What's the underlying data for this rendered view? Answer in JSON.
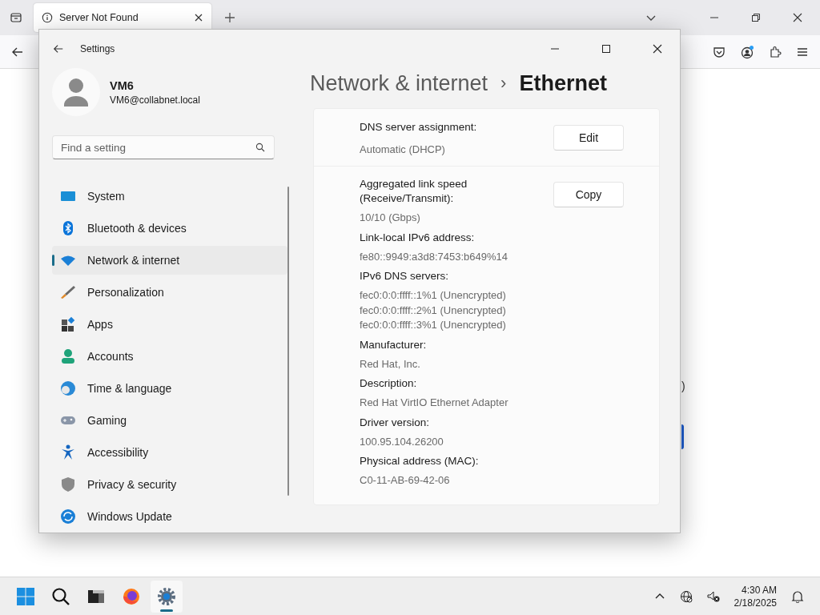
{
  "browser": {
    "tab": {
      "title": "Server Not Found",
      "selected": true
    },
    "page_fragment": ")"
  },
  "settings": {
    "title": "Settings",
    "user": {
      "name": "VM6",
      "email": "VM6@collabnet.local"
    },
    "search": {
      "placeholder": "Find a setting"
    },
    "nav": [
      {
        "label": "System",
        "selected": false
      },
      {
        "label": "Bluetooth & devices",
        "selected": false
      },
      {
        "label": "Network & internet",
        "selected": true
      },
      {
        "label": "Personalization",
        "selected": false
      },
      {
        "label": "Apps",
        "selected": false
      },
      {
        "label": "Accounts",
        "selected": false
      },
      {
        "label": "Time & language",
        "selected": false
      },
      {
        "label": "Gaming",
        "selected": false
      },
      {
        "label": "Accessibility",
        "selected": false
      },
      {
        "label": "Privacy & security",
        "selected": false
      },
      {
        "label": "Windows Update",
        "selected": false
      }
    ],
    "breadcrumb": {
      "parent": "Network & internet",
      "separator": "›",
      "current": "Ethernet"
    },
    "dns": {
      "label": "DNS server assignment:",
      "value": "Automatic (DHCP)",
      "button": "Edit"
    },
    "copy_button": "Copy",
    "properties": [
      {
        "label": "Aggregated link speed (Receive/Transmit):",
        "values": [
          "10/10 (Gbps)"
        ]
      },
      {
        "label": "Link-local IPv6 address:",
        "values": [
          "fe80::9949:a3d8:7453:b649%14"
        ]
      },
      {
        "label": "IPv6 DNS servers:",
        "values": [
          "fec0:0:0:ffff::1%1 (Unencrypted)",
          "fec0:0:0:ffff::2%1 (Unencrypted)",
          "fec0:0:0:ffff::3%1 (Unencrypted)"
        ]
      },
      {
        "label": "Manufacturer:",
        "values": [
          "Red Hat, Inc."
        ]
      },
      {
        "label": "Description:",
        "values": [
          "Red Hat VirtIO Ethernet Adapter"
        ]
      },
      {
        "label": "Driver version:",
        "values": [
          "100.95.104.26200"
        ]
      },
      {
        "label": "Physical address (MAC):",
        "values": [
          "C0-11-AB-69-42-06"
        ]
      }
    ]
  },
  "taskbar": {
    "apps": [
      {
        "selected": false
      },
      {
        "selected": false
      },
      {
        "selected": false
      },
      {
        "selected": false
      },
      {
        "selected": true
      }
    ],
    "time": "4:30 AM",
    "date": "2/18/2025"
  }
}
